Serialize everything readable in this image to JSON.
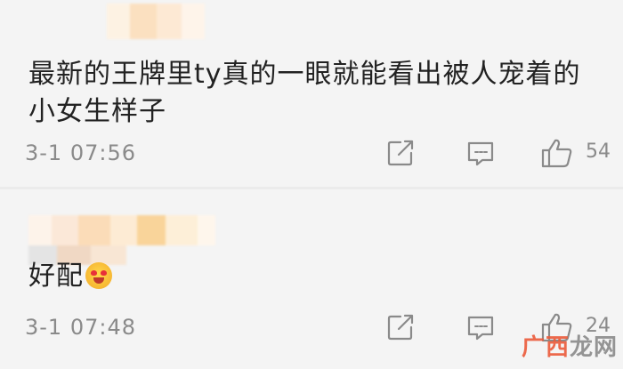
{
  "comments": [
    {
      "text": "最新的王牌里ty真的一眼就能看出被人宠着的小女生样子",
      "timestamp": "3-1 07:56",
      "like_count": "54",
      "username_obscured": true
    },
    {
      "text": "好配",
      "emoji": "smiling-face-with-heart-eyes",
      "timestamp": "3-1 07:48",
      "like_count": "24",
      "username_obscured": true
    }
  ],
  "icons": {
    "share": "share-icon",
    "reply": "comment-icon",
    "like": "thumbs-up-icon"
  },
  "watermark": {
    "part1": "广西",
    "part2": "龙网"
  },
  "colors": {
    "background": "#f4f4f4",
    "text": "#222222",
    "meta": "#8a8a8a",
    "watermark": "#ec5b3a"
  }
}
